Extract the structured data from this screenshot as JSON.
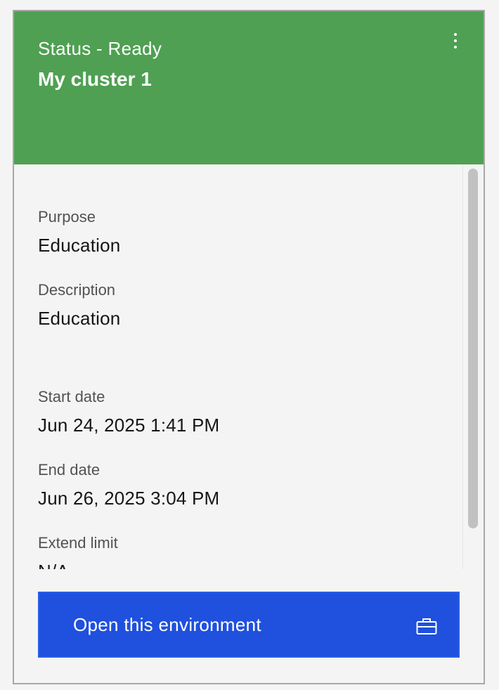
{
  "header": {
    "status": "Status - Ready",
    "title": "My cluster 1",
    "menu_icon": "overflow-menu-vertical-icon",
    "background_color": "#4fa052"
  },
  "details": {
    "purpose_label": "Purpose",
    "purpose_value": "Education",
    "description_label": "Description",
    "description_value": "Education",
    "start_date_label": "Start date",
    "start_date_value": "Jun 24, 2025 1:41 PM",
    "end_date_label": "End date",
    "end_date_value": "Jun 26, 2025 3:04 PM",
    "extend_limit_label": "Extend limit",
    "extend_limit_value": "N/A"
  },
  "action": {
    "open_label": "Open this environment",
    "icon": "briefcase-icon",
    "button_color": "#1f50de"
  }
}
